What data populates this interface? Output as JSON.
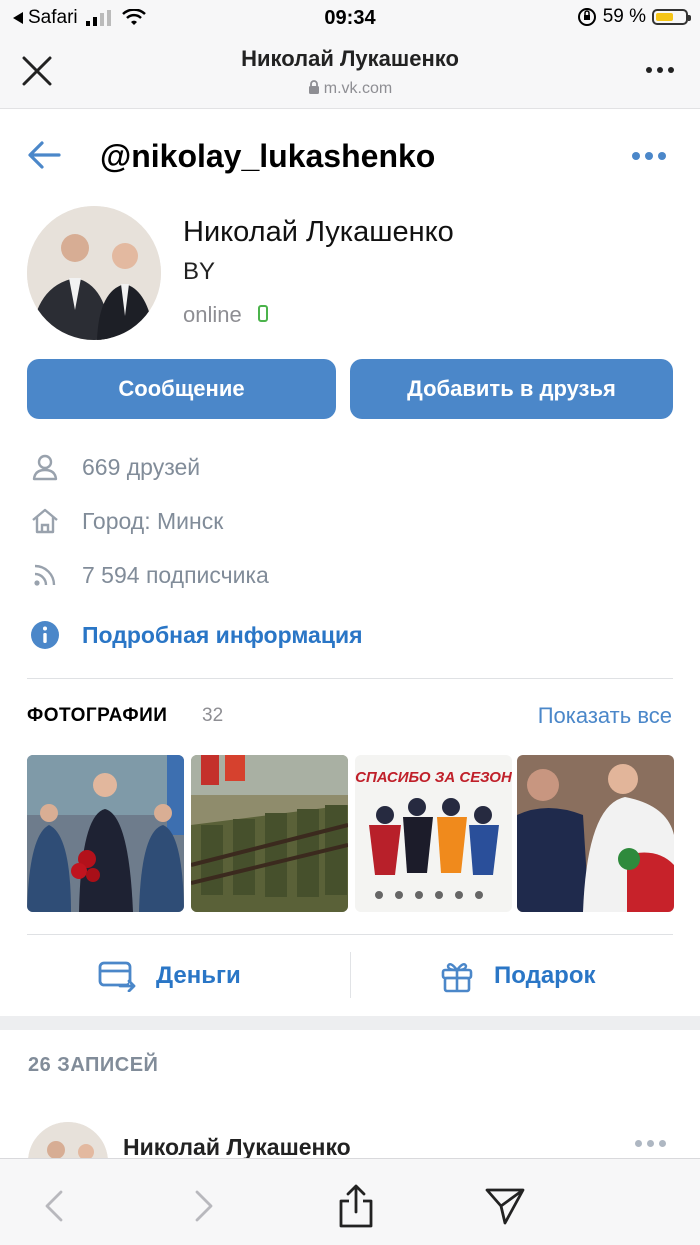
{
  "status_bar": {
    "back_app": "Safari",
    "time": "09:34",
    "battery": "59 %",
    "battery_level": 0.59
  },
  "browser": {
    "page_title": "Николай Лукашенко",
    "url": "m.vk.com"
  },
  "profile": {
    "handle": "@nikolay_lukashenko",
    "name": "Николай Лукашенко",
    "country": "BY",
    "status": "online",
    "buttons": {
      "message": "Сообщение",
      "add_friend": "Добавить в друзья"
    },
    "info": [
      {
        "icon": "user-icon",
        "text": "669 друзей"
      },
      {
        "icon": "home-icon",
        "text": "Город: Минск"
      },
      {
        "icon": "rss-icon",
        "text": "7 594 подписчика"
      }
    ],
    "more_info": "Подробная информация"
  },
  "photos": {
    "title": "ФОТОГРАФИИ",
    "count": "32",
    "show_all": "Показать все",
    "poster_headline": "СПАСИБО ЗА СЕЗОН"
  },
  "actions": {
    "money": "Деньги",
    "gift": "Подарок"
  },
  "posts": {
    "count_label": "26 ЗАПИСЕЙ",
    "first_author": "Николай Лукашенко"
  },
  "colors": {
    "accent": "#4b87c9",
    "link": "#2a76c6",
    "muted": "#818c99",
    "online": "#4bb34b"
  }
}
